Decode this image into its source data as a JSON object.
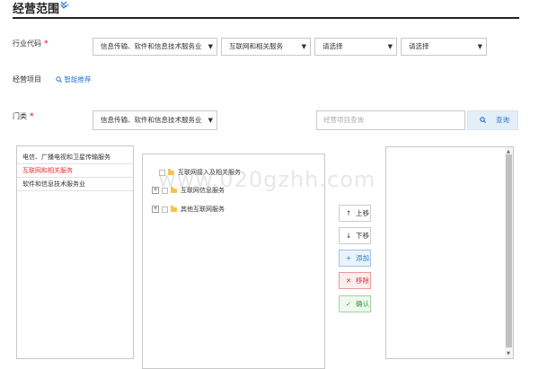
{
  "header": {
    "title": "经营范围",
    "toggle_icon": "double-chevron-down-icon"
  },
  "industry": {
    "label": "行业代码",
    "required_mark": "*",
    "selects": [
      "信息传输、软件和信息技术服务业",
      "互联网和相关服务",
      "请选择",
      "请选择"
    ]
  },
  "business": {
    "label": "经营项目",
    "smart_link": "智能推荐"
  },
  "category": {
    "label": "门类",
    "required_mark": "*",
    "select_value": "信息传输、软件和信息技术服务业",
    "search_placeholder": "经营项目查询",
    "search_button": "查询"
  },
  "category_list": [
    "电信、广播电视和卫星传输服务",
    "互联网和相关服务",
    "软件和信息技术服务业"
  ],
  "tree": [
    "互联网接入及相关服务",
    "互联网信息服务",
    "其他互联网服务"
  ],
  "actions": {
    "up": "上移",
    "down": "下移",
    "add": "添加",
    "remove": "移除",
    "confirm": "确认"
  },
  "watermark": "www.020gzhh.com"
}
